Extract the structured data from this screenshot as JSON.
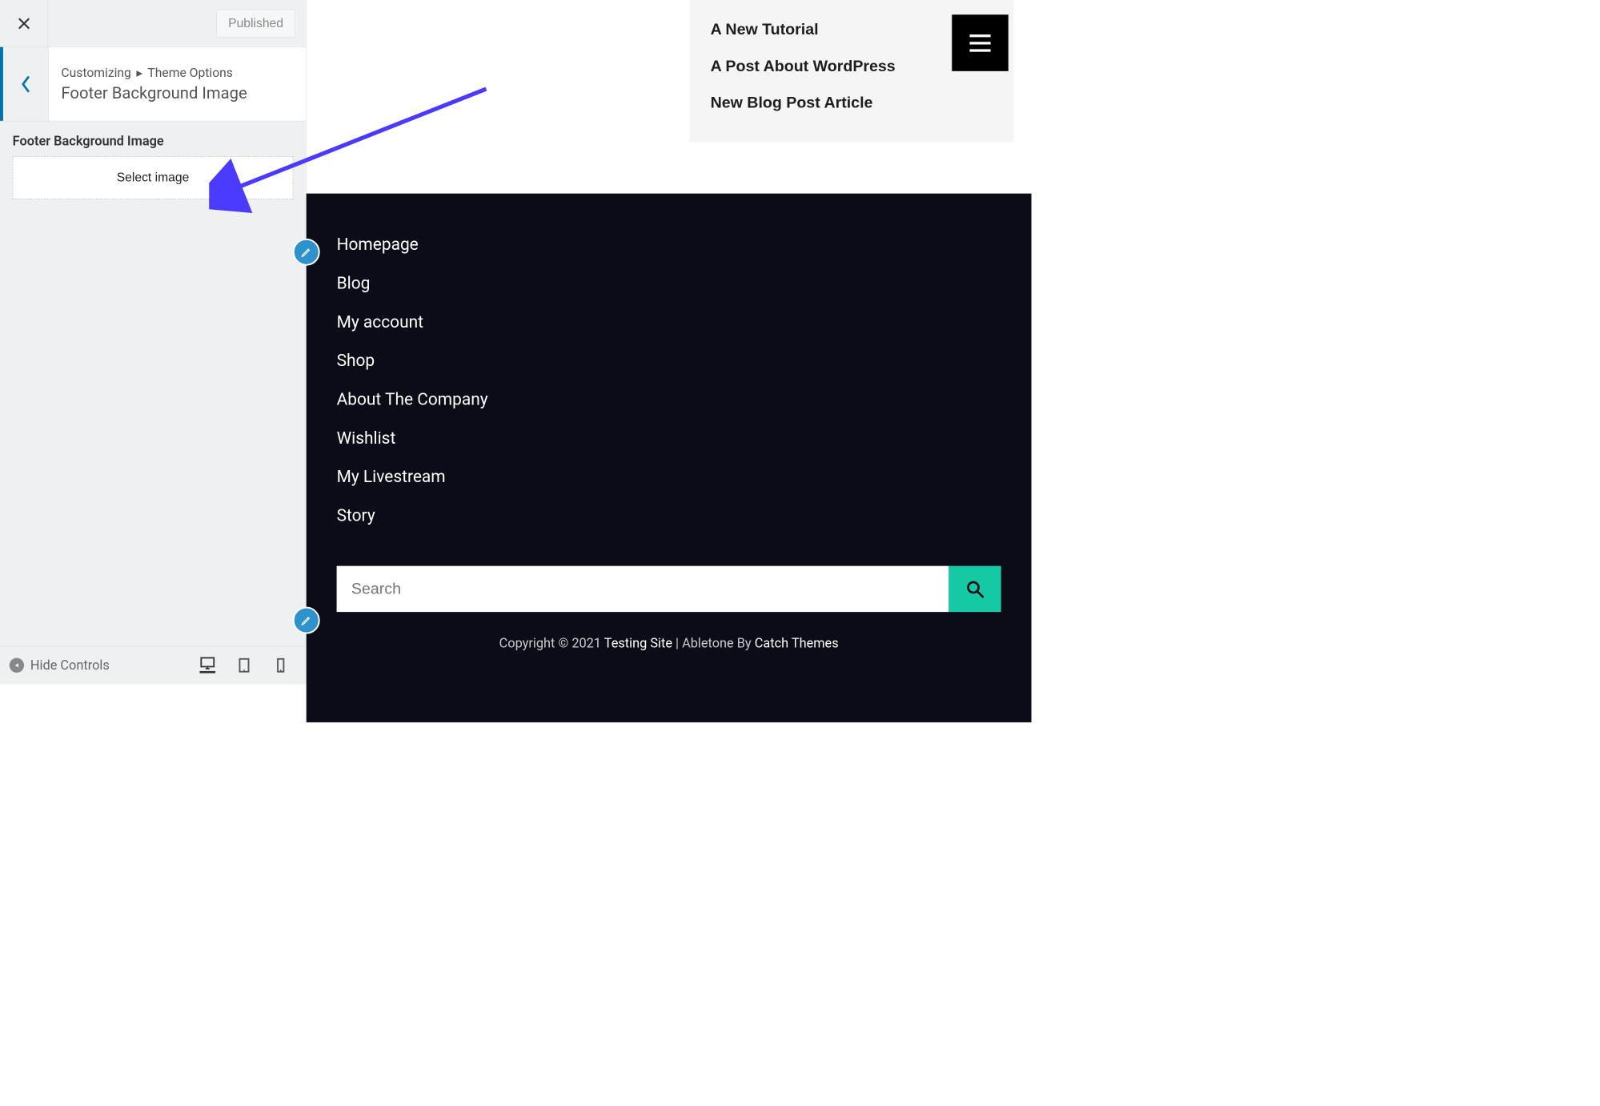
{
  "sidebar": {
    "publish_label": "Published",
    "breadcrumb_root": "Customizing",
    "breadcrumb_sep": "▸",
    "breadcrumb_parent": "Theme Options",
    "section_title": "Footer Background Image",
    "control_label": "Footer Background Image",
    "select_image_label": "Select image",
    "hide_controls_label": "Hide Controls"
  },
  "recent_posts": {
    "items": [
      "A New Tutorial",
      "A Post About WordPress",
      "New Blog Post Article"
    ]
  },
  "footer_menu": {
    "items": [
      "Homepage",
      "Blog",
      "My account",
      "Shop",
      "About The Company",
      "Wishlist",
      "My Livestream",
      "Story"
    ]
  },
  "search": {
    "placeholder": "Search"
  },
  "copyright": {
    "prefix": "Copyright © 2021 ",
    "site": "Testing Site",
    "mid": " | Abletone By ",
    "theme": "Catch Themes"
  }
}
